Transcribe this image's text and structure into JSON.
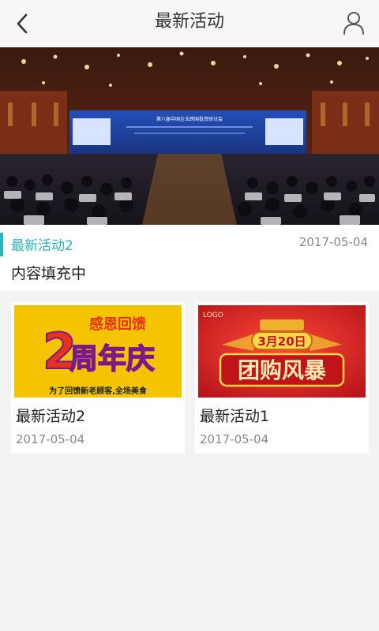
{
  "header": {
    "title": "最新活动"
  },
  "featured": {
    "title": "最新活动2",
    "date": "2017-05-04",
    "content": "内容填充中"
  },
  "banner": {
    "screen_text": "第八届中国企业跨国投资研讨会"
  },
  "cards": [
    {
      "title": "最新活动2",
      "date": "2017-05-04",
      "image": {
        "top_text": "感恩回馈",
        "big_number": "2",
        "main_text": "周年庆",
        "bottom_text": "为了回馈新老顾客,全场美食"
      }
    },
    {
      "title": "最新活动1",
      "date": "2017-05-04",
      "image": {
        "logo_text": "LOGO",
        "date_text": "3月20日",
        "main_text": "团购风暴"
      }
    }
  ],
  "colors": {
    "accent": "#2bb5b8",
    "header_bg": "#f7f7f7",
    "page_bg": "#f3f3f3"
  },
  "icons": {
    "back": "chevron-left-icon",
    "user": "user-icon"
  }
}
